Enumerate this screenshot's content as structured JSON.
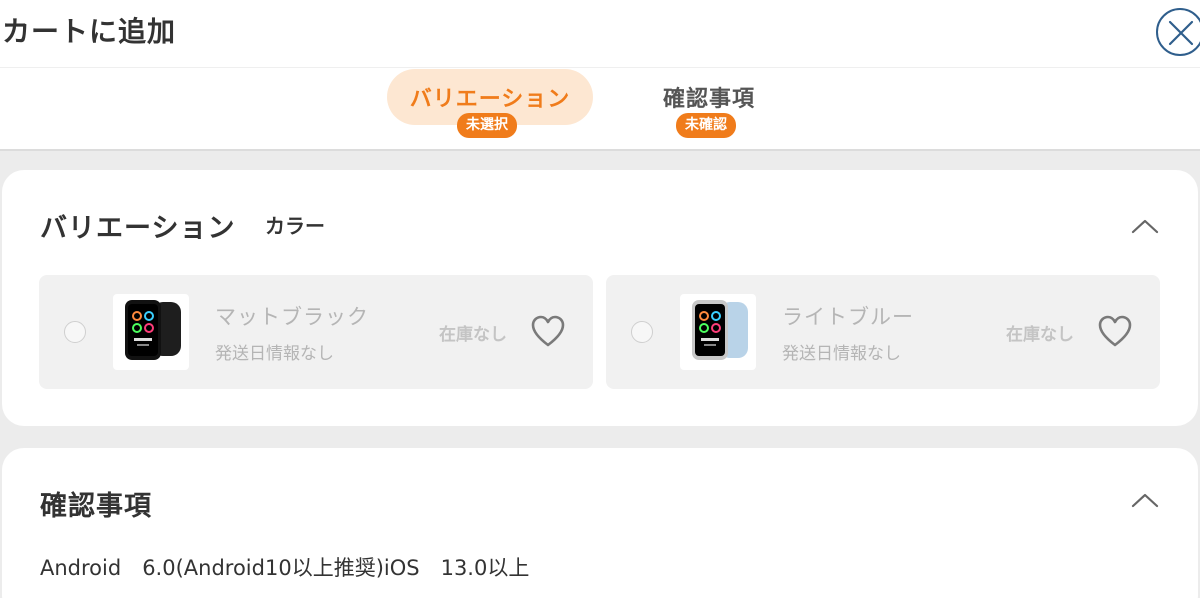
{
  "header": {
    "title": "カートに追加",
    "close_icon": "close-icon"
  },
  "tabs": [
    {
      "label": "バリエーション",
      "badge": "未選択",
      "active": true
    },
    {
      "label": "確認事項",
      "badge": "未確認",
      "active": false
    }
  ],
  "variation_section": {
    "heading": "バリエーション",
    "subheading": "カラー",
    "collapse_icon": "chevron-up-icon",
    "options": [
      {
        "name": "マットブラック",
        "shipping": "発送日情報なし",
        "stock": "在庫なし",
        "favorite_icon": "heart-icon"
      },
      {
        "name": "ライトブルー",
        "shipping": "発送日情報なし",
        "stock": "在庫なし",
        "favorite_icon": "heart-icon"
      }
    ]
  },
  "confirm_section": {
    "heading": "確認事項",
    "collapse_icon": "chevron-up-icon",
    "spec": "Android　6.0(Android10以上推奨)iOS　13.0以上"
  },
  "colors": {
    "accent": "#f07c1b",
    "accent_light": "#fde7d2",
    "close_border": "#2f5e8c",
    "background": "#ececec"
  }
}
